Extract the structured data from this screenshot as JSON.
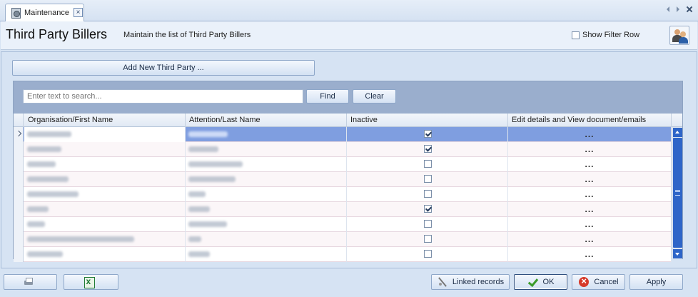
{
  "tab": {
    "label": "Maintenance",
    "close_glyph": "×"
  },
  "header": {
    "title": "Third Party Billers",
    "subtitle": "Maintain the list of Third Party Billers",
    "show_filter_row_label": "Show Filter Row",
    "show_filter_row_checked": false
  },
  "toolbar": {
    "add_label": "Add New Third Party ..."
  },
  "search": {
    "placeholder": "Enter text to search...",
    "value": "",
    "find_label": "Find",
    "clear_label": "Clear"
  },
  "grid": {
    "columns": [
      "Organisation/First Name",
      "Attention/Last Name",
      "Inactive",
      "Edit details and View document/emails"
    ],
    "rows": [
      {
        "org": "Redacted",
        "attention": "Redacted",
        "inactive": true,
        "action": "...",
        "selected": true
      },
      {
        "org": "Redacted",
        "attention": "Redacted",
        "inactive": true,
        "action": "..."
      },
      {
        "org": "Redacted",
        "attention": "Redacted",
        "inactive": false,
        "action": "..."
      },
      {
        "org": "Redacted",
        "attention": "Redacted",
        "inactive": false,
        "action": "..."
      },
      {
        "org": "Redacted",
        "attention": "Redacted",
        "inactive": false,
        "action": "..."
      },
      {
        "org": "Redacted",
        "attention": "Redacted",
        "inactive": true,
        "action": "..."
      },
      {
        "org": "Redacted",
        "attention": "Redacted",
        "inactive": false,
        "action": "..."
      },
      {
        "org": "Redacted",
        "attention": "Redacted",
        "inactive": false,
        "action": "..."
      },
      {
        "org": "Redacted",
        "attention": "Redacted",
        "inactive": false,
        "action": "..."
      }
    ]
  },
  "footer": {
    "linked_records_label": "Linked records",
    "ok_label": "OK",
    "cancel_label": "Cancel",
    "apply_label": "Apply"
  },
  "colors": {
    "accent": "#2e65c8",
    "selected_row": "#7f9ee0",
    "panel": "#d6e3f3"
  },
  "icons": [
    "maintenance-icon",
    "users-icon",
    "print-icon",
    "excel-icon",
    "link-icon",
    "check-icon",
    "cancel-icon"
  ]
}
